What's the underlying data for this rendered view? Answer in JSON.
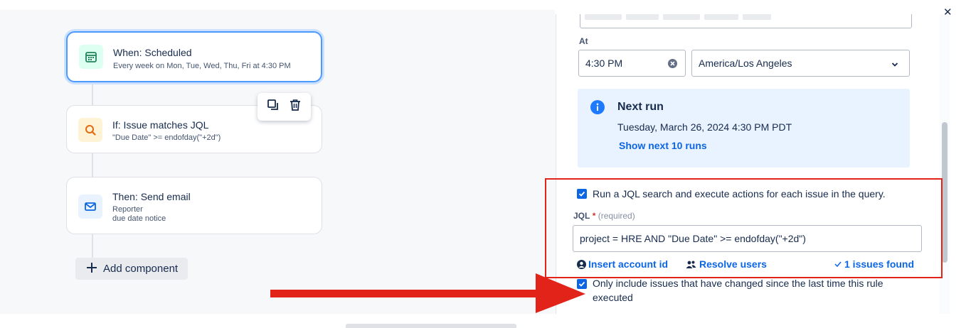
{
  "canvas": {
    "trigger": {
      "title": "When: Scheduled",
      "subtitle": "Every week on Mon, Tue, Wed, Thu, Fri at 4:30 PM",
      "icon": "calendar-icon"
    },
    "condition": {
      "title": "If: Issue matches JQL",
      "subtitle": "\"Due Date\" >= endofday(\"+2d\")",
      "icon": "search-icon"
    },
    "action": {
      "title": "Then: Send email",
      "line1": "Reporter",
      "line2": "due date notice",
      "icon": "envelope-icon"
    },
    "add_component_label": "Add component",
    "hover_tools": [
      "duplicate-icon",
      "trash-icon"
    ]
  },
  "panel": {
    "at_label": "At",
    "time_value": "4:30 PM",
    "timezone_value": "America/Los Angeles",
    "next_run": {
      "title": "Next run",
      "date": "Tuesday, March 26, 2024 4:30 PM PDT",
      "link": "Show next 10 runs"
    },
    "jql_checkbox_label": "Run a JQL search and execute actions for each issue in the query.",
    "jql_label": "JQL",
    "required_mark": "*",
    "required_hint": "(required)",
    "jql_value": "project = HRE AND \"Due Date\" >= endofday(\"+2d\")",
    "insert_account_id": "Insert account id",
    "resolve_users": "Resolve users",
    "issues_found": "1 issues found",
    "only_changed_line1": "Only include issues that have changed since the last time this rule",
    "only_changed_line2": "executed"
  },
  "colors": {
    "accent": "#0c66e4",
    "annotation_red": "#e2231a",
    "selected_border": "#4c9aff"
  }
}
